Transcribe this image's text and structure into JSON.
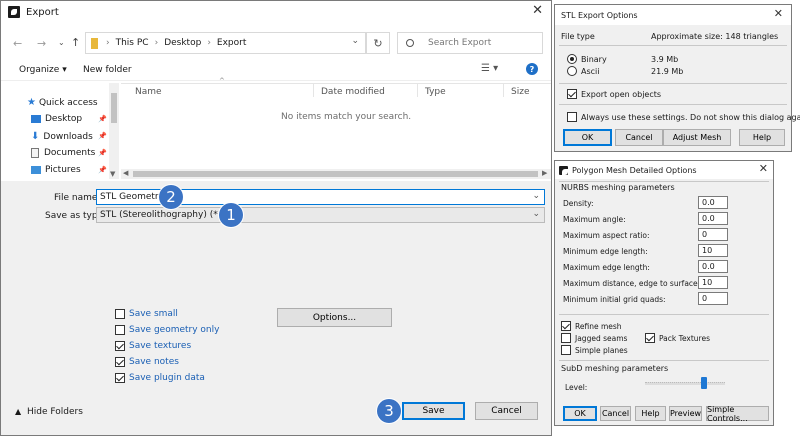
{
  "export_dialog": {
    "title": "Export",
    "address": {
      "root": "This PC",
      "desktop": "Desktop",
      "export": "Export"
    },
    "search_placeholder": "Search Export",
    "toolbar": {
      "organize": "Organize",
      "new_folder": "New folder"
    },
    "nav": {
      "quick_access": "Quick access",
      "desktop": "Desktop",
      "downloads": "Downloads",
      "documents": "Documents",
      "pictures": "Pictures"
    },
    "columns": {
      "name": "Name",
      "date": "Date modified",
      "type": "Type",
      "size": "Size"
    },
    "empty_text": "No items match your search.",
    "file_name_label": "File name:",
    "file_name_value": "STL Geometry",
    "save_type_label": "Save as type:",
    "save_type_value": "STL (Stereolithography) (*.stl)",
    "options": {
      "save_small": "Save small",
      "save_geometry_only": "Save geometry only",
      "save_textures": "Save textures",
      "save_notes": "Save notes",
      "save_plugin_data": "Save plugin data"
    },
    "options_button": "Options...",
    "hide_folders": "Hide Folders",
    "save_button": "Save",
    "cancel_button": "Cancel",
    "badges": {
      "one": "1",
      "two": "2",
      "three": "3"
    }
  },
  "stl_dialog": {
    "title": "STL Export Options",
    "file_type_label": "File type",
    "approx_size": "Approximate size: 148 triangles",
    "binary_label": "Binary",
    "binary_size": "3.9 Mb",
    "ascii_label": "Ascii",
    "ascii_size": "21.9 Mb",
    "export_open_objects": "Export open objects",
    "always_use": "Always use these settings. Do not show this dialog again",
    "ok": "OK",
    "cancel": "Cancel",
    "adjust_mesh": "Adjust Mesh",
    "help": "Help"
  },
  "mesh_dialog": {
    "title": "Polygon Mesh Detailed Options",
    "nurbs_header": "NURBS meshing parameters",
    "params": [
      {
        "label": "Density:",
        "value": "0.0"
      },
      {
        "label": "Maximum angle:",
        "value": "0.0"
      },
      {
        "label": "Maximum aspect ratio:",
        "value": "0"
      },
      {
        "label": "Minimum edge length:",
        "value": "10"
      },
      {
        "label": "Maximum edge length:",
        "value": "0.0"
      },
      {
        "label": "Maximum distance, edge to surface:",
        "value": "10"
      },
      {
        "label": "Minimum initial grid quads:",
        "value": "0"
      }
    ],
    "refine_mesh": "Refine mesh",
    "jagged_seams": "Jagged seams",
    "pack_textures": "Pack Textures",
    "simple_planes": "Simple planes",
    "subd_header": "SubD meshing parameters",
    "level_label": "Level:",
    "ok": "OK",
    "cancel": "Cancel",
    "help": "Help",
    "preview": "Preview",
    "simple_controls": "Simple Controls..."
  }
}
